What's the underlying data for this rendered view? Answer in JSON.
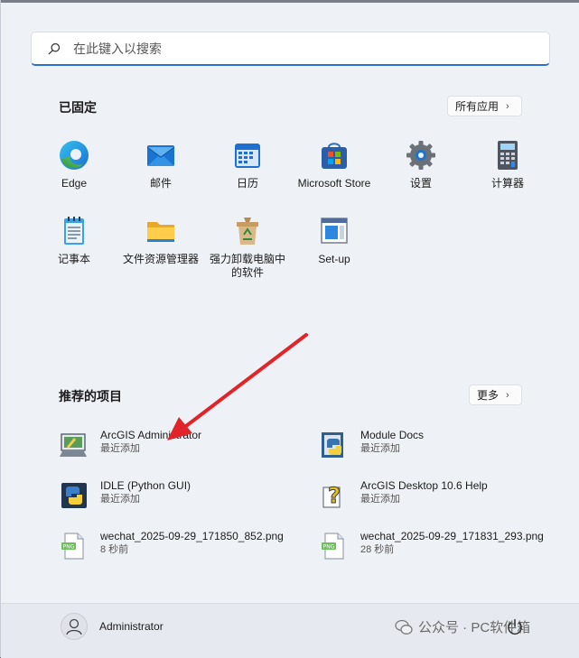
{
  "search": {
    "placeholder": "在此键入以搜索"
  },
  "pinned": {
    "title": "已固定",
    "all_apps_label": "所有应用",
    "apps": [
      {
        "label": "Edge"
      },
      {
        "label": "邮件"
      },
      {
        "label": "日历"
      },
      {
        "label": "Microsoft Store"
      },
      {
        "label": "设置"
      },
      {
        "label": "计算器"
      },
      {
        "label": "记事本"
      },
      {
        "label": "文件资源管理器"
      },
      {
        "label": "强力卸载电脑中的软件"
      },
      {
        "label": "Set-up"
      }
    ]
  },
  "recommended": {
    "title": "推荐的项目",
    "more_label": "更多",
    "items": [
      {
        "name": "ArcGIS Administrator",
        "sub": "最近添加",
        "icon": "arcgis-admin-icon"
      },
      {
        "name": "Module Docs",
        "sub": "最近添加",
        "icon": "python-docs-icon"
      },
      {
        "name": "IDLE (Python GUI)",
        "sub": "最近添加",
        "icon": "python-idle-icon"
      },
      {
        "name": "ArcGIS Desktop 10.6 Help",
        "sub": "最近添加",
        "icon": "help-icon"
      },
      {
        "name": "wechat_2025-09-29_171850_852.png",
        "sub": "8 秒前",
        "icon": "png-file-icon"
      },
      {
        "name": "wechat_2025-09-29_171831_293.png",
        "sub": "28 秒前",
        "icon": "png-file-icon"
      }
    ]
  },
  "footer": {
    "user_name": "Administrator",
    "watermark": "公众号 · PC软件箱"
  },
  "colors": {
    "accent": "#2a6fd6",
    "arrow": "#e0242a"
  }
}
